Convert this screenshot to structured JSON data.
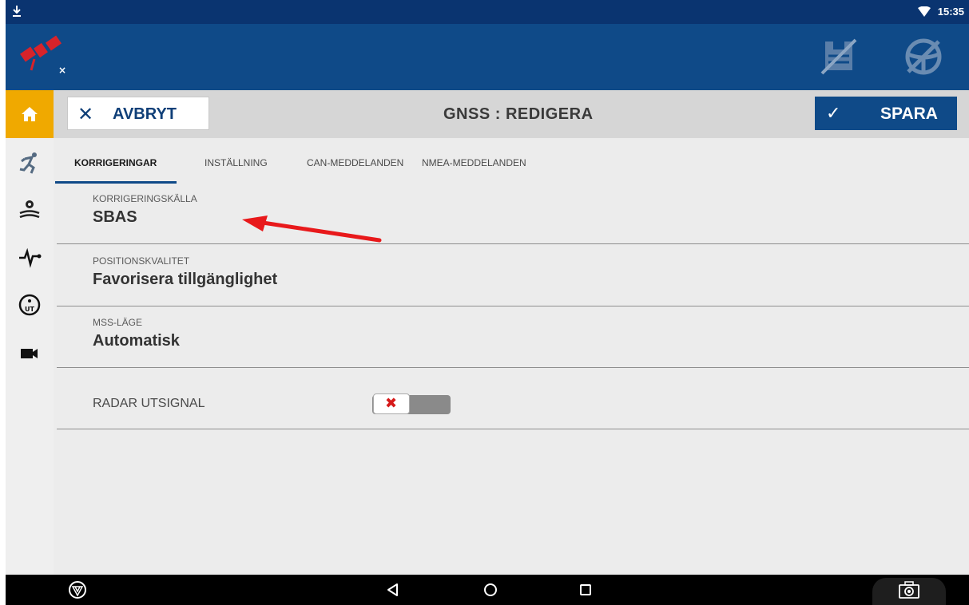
{
  "status_bar": {
    "time": "15:35"
  },
  "header": {
    "cancel_label": "AVBRYT",
    "title": "GNSS : REDIGERA",
    "save_label": "SPARA"
  },
  "tabs": [
    {
      "label": "KORRIGERINGAR",
      "active": true
    },
    {
      "label": "INSTÄLLNING",
      "active": false
    },
    {
      "label": "CAN-MEDDELANDEN",
      "active": false
    },
    {
      "label": "NMEA-MEDDELANDEN",
      "active": false
    }
  ],
  "settings": [
    {
      "caption": "KORRIGERINGSKÄLLA",
      "value": "SBAS"
    },
    {
      "caption": "POSITIONSKVALITET",
      "value": "Favorisera tillgänglighet"
    },
    {
      "caption": "MSS-LÄGE",
      "value": "Automatisk"
    }
  ],
  "radar_output": {
    "label": "RADAR UTSIGNAL",
    "enabled": false
  },
  "icons": {
    "status": [
      "download-icon",
      "wifi-icon"
    ],
    "header": [
      "satellite-disconnected-icon",
      "implement-disabled-icon",
      "steering-disabled-icon"
    ],
    "sidebar": [
      "home-icon",
      "runner-icon",
      "field-settings-icon",
      "pulse-icon",
      "output-icon",
      "camera-icon"
    ],
    "nav": [
      "brand-logo-icon",
      "back-icon",
      "home-circle-icon",
      "recents-icon",
      "screenshot-camera-icon"
    ]
  },
  "colors": {
    "primary": "#0f4a88",
    "status_bar": "#0a3470",
    "home_accent": "#f0a900",
    "annotation_arrow": "#e8191b"
  }
}
